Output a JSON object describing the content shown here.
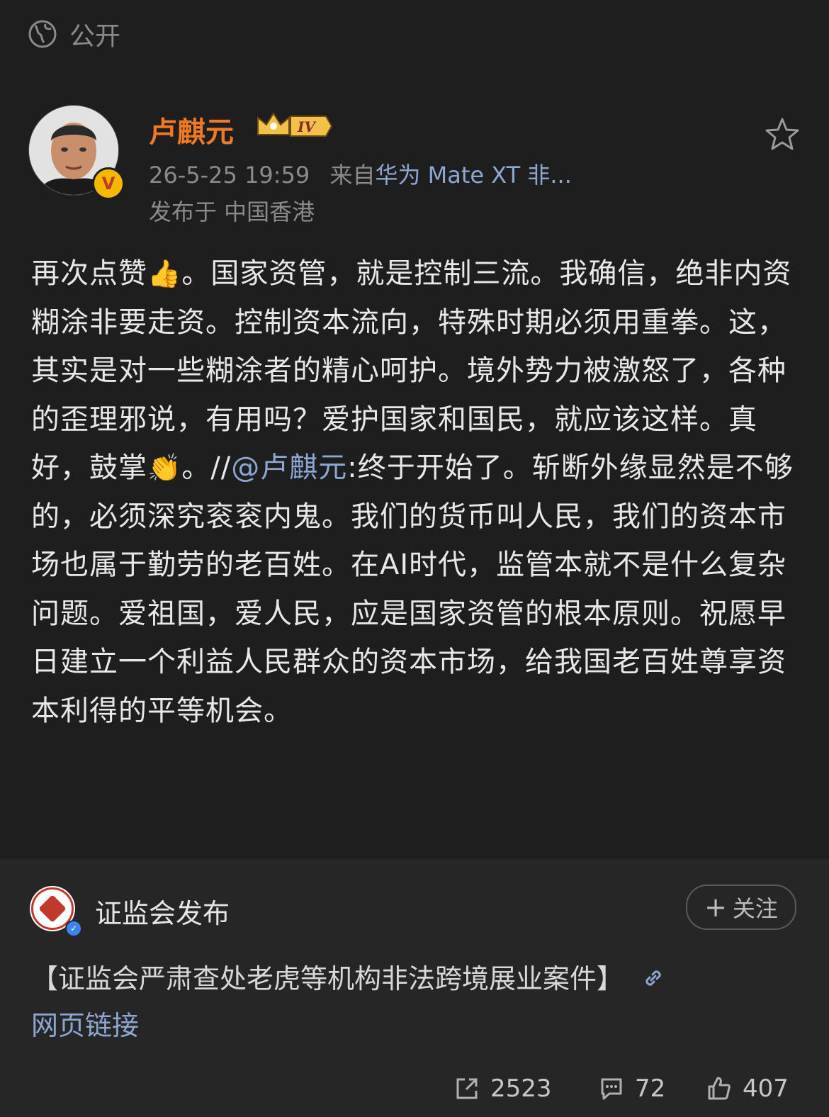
{
  "visibility": {
    "icon": "globe-icon",
    "label": "公开"
  },
  "author": {
    "name": "卢麒元",
    "level_badge": "IV",
    "verified_icon": "v-badge-icon"
  },
  "post_meta": {
    "date_time": "26-5-25 19:59",
    "source_prefix": "来自",
    "source_device": "华为 Mate XT 非...",
    "location": "发布于 中国香港"
  },
  "content": {
    "part1": "再次点赞",
    "emoji1": "👍",
    "part2": "。国家资管，就是控制三流。我确信，绝非内资糊涂非要走资。控制资本流向，特殊时期必须用重拳。这，其实是对一些糊涂者的精心呵护。境外势力被激怒了，各种的歪理邪说，有用吗？爱护国家和国民，就应该这样。真好，鼓掌",
    "emoji2": "👏",
    "part3": "。//",
    "mention": "@卢麒元",
    "part4": ":终于开始了。斩断外缘显然是不够的，必须深究衮衮内鬼。我们的货币叫人民，我们的资本市场也属于勤劳的老百姓。在AI时代，监管本就不是什么复杂问题。爱祖国，爱人民，应是国家资管的根本原则。祝愿早日建立一个利益人民群众的资本市场，给我国老百姓尊享资本利得的平等机会。"
  },
  "repost": {
    "author": "证监会发布",
    "follow_plus": "+",
    "follow_label": "关注",
    "text": "【证监会严肃查处老虎等机构非法跨境展业案件】",
    "link_label": "网页链接"
  },
  "actions": {
    "share_count": "2523",
    "comment_count": "72",
    "like_count": "407"
  },
  "colors": {
    "background": "#1e1e1e",
    "author_name": "#f07a22",
    "link": "#8ea6d4"
  }
}
